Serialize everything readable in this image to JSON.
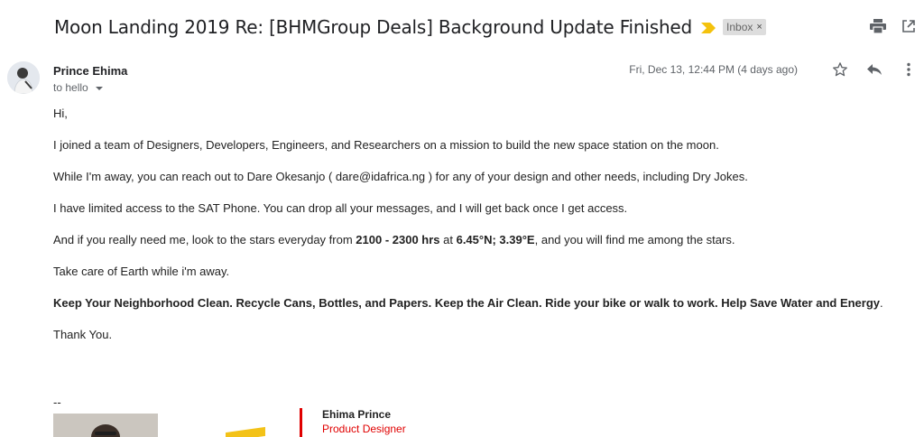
{
  "email": {
    "subject": "Moon Landing 2019 Re: [BHMGroup Deals] Background Update Finished",
    "label": "Inbox",
    "label_close": "×",
    "sender_name": "Prince Ehima",
    "recipient_text": "to hello",
    "date": "Fri, Dec 13, 12:44 PM (4 days ago)"
  },
  "toolbar_icons": {
    "print": "print-icon",
    "popout": "open-in-new-window-icon",
    "star": "star-icon",
    "reply": "reply-icon",
    "more": "more-vertical-icon",
    "importance": "importance-marker-icon"
  },
  "body": {
    "greeting": "Hi,",
    "p1": "I joined a team of Designers, Developers, Engineers, and Researchers on a mission to build the new space station on the moon.",
    "p2": "While I'm away, you can reach out to Dare Okesanjo ( dare@idafrica.ng ) for any of your design and other needs, including Dry Jokes.",
    "p3": "I have limited access to the SAT Phone. You can drop all your messages, and I will get back once I get access.",
    "p4_a": "And if you really need me, look to the stars everyday from ",
    "p4_time": "2100 - 2300 hrs",
    "p4_b": " at ",
    "p4_coords": "6.45°N; 3.39°E",
    "p4_c": ", and you will find me among the stars.",
    "p5": "Take care of Earth while i'm away.",
    "p6_bold": "Keep Your Neighborhood Clean. Recycle Cans, Bottles, and Papers. Keep the Air Clean. Ride your bike or walk to work. Help Save Water and Energy",
    "p6_end": ".",
    "p7": "Thank You."
  },
  "signature": {
    "dashes": "--",
    "name": "Ehima Prince",
    "role": "Product Designer"
  },
  "colors": {
    "importance": "#f4c20d",
    "signature_accent": "#e00000",
    "muted": "#5f6368"
  }
}
